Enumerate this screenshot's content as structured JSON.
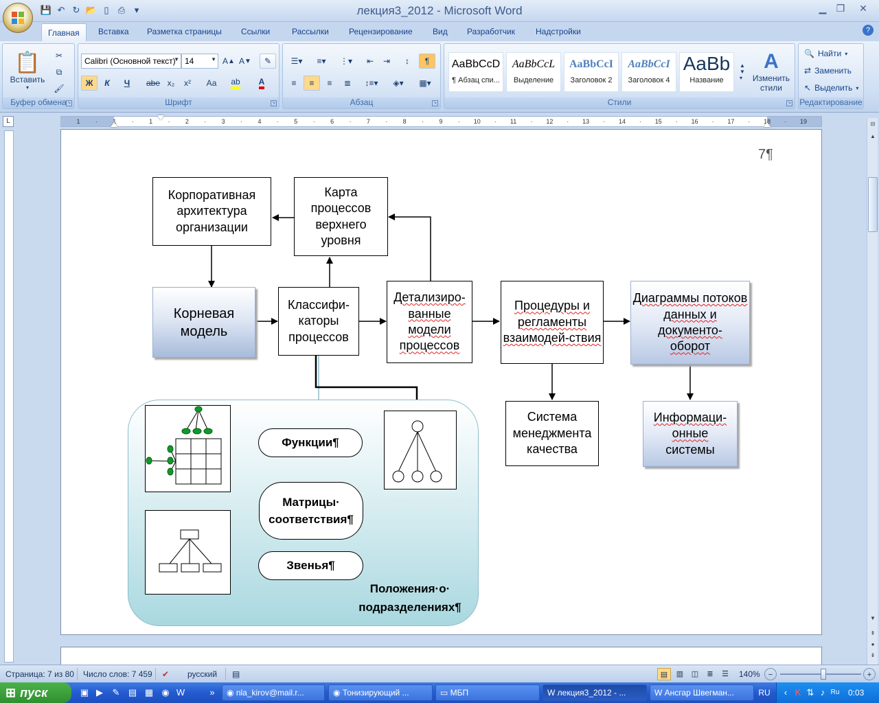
{
  "window": {
    "title": "лекция3_2012 - Microsoft Word"
  },
  "tabs": [
    "Главная",
    "Вставка",
    "Разметка страницы",
    "Ссылки",
    "Рассылки",
    "Рецензирование",
    "Вид",
    "Разработчик",
    "Надстройки"
  ],
  "ribbon": {
    "clipboard": {
      "paste_label": "Вставить",
      "group_label": "Буфер обмена"
    },
    "font": {
      "font_name": "Calibri (Основной текст)",
      "font_size": "14",
      "bold": "Ж",
      "italic": "К",
      "underline": "Ч",
      "strike": "abe",
      "subscript": "x₂",
      "superscript": "x²",
      "case": "Аа",
      "group_label": "Шрифт"
    },
    "paragraph": {
      "group_label": "Абзац"
    },
    "styles": {
      "group_label": "Стили",
      "change_label": "Изменить стили",
      "tiles": [
        {
          "sample": "AaBbCcD",
          "name": "¶ Абзац спи..."
        },
        {
          "sample": "AaBbCcL",
          "name": "Выделение"
        },
        {
          "sample": "AaBbCcI",
          "name": "Заголовок 2"
        },
        {
          "sample": "AaBbCcI",
          "name": "Заголовок 4"
        },
        {
          "sample": "AaBb",
          "name": "Название"
        }
      ]
    },
    "editing": {
      "find": "Найти",
      "replace": "Заменить",
      "select": "Выделить",
      "group_label": "Редактирование"
    }
  },
  "ruler": {
    "ticks": [
      "1",
      "·",
      "1",
      "·",
      "1",
      "·",
      "2",
      "·",
      "3",
      "·",
      "4",
      "·",
      "5",
      "·",
      "6",
      "·",
      "7",
      "·",
      "8",
      "·",
      "9",
      "·",
      "10",
      "·",
      "11",
      "·",
      "12",
      "·",
      "13",
      "·",
      "14",
      "·",
      "15",
      "·",
      "16",
      "·",
      "17",
      "·",
      "18",
      "·",
      "19"
    ]
  },
  "document": {
    "page_number": "7¶",
    "boxes": {
      "corp_arch": "Корпоративная архитектура организации",
      "process_map": "Карта процессов верхнего уровня",
      "root_model": "Корневая модель",
      "classifiers": "Классифи-каторы процессов",
      "detailed_models": "Детализиро-ванные модели процессов",
      "procedures": "Процедуры и регламенты взаимодей-ствия",
      "dfd_line1": "Диаграммы потоков данных и документо-",
      "dfd_line2": "оборот",
      "qms": "Система менеджмента качества",
      "is_line1": "Информаци-",
      "is_line2": "онные",
      "is_line3": "системы"
    },
    "pills": {
      "functions": "Функции¶",
      "matrices_line1": "Матрицы·",
      "matrices_line2": "соответствия¶",
      "units": "Звенья¶"
    },
    "caption_line1": "Положения·о·",
    "caption_line2": "подразделениях¶"
  },
  "statusbar": {
    "page": "Страница: 7 из 80",
    "words": "Число слов: 7 459",
    "language": "русский",
    "zoom": "140%"
  },
  "taskbar": {
    "start": "пуск",
    "tasks": [
      "nla_kirov@mail.r...",
      "Тонизирующий ...",
      "МБП",
      "лекция3_2012 - ...",
      "Ансгар Швегман..."
    ],
    "lang": "RU",
    "time": "0:03"
  },
  "colors": {
    "accent": "#15428b",
    "ribbon_bg": "#cfdff3",
    "taskbar": "#235bd0",
    "start": "#3ea63e"
  }
}
